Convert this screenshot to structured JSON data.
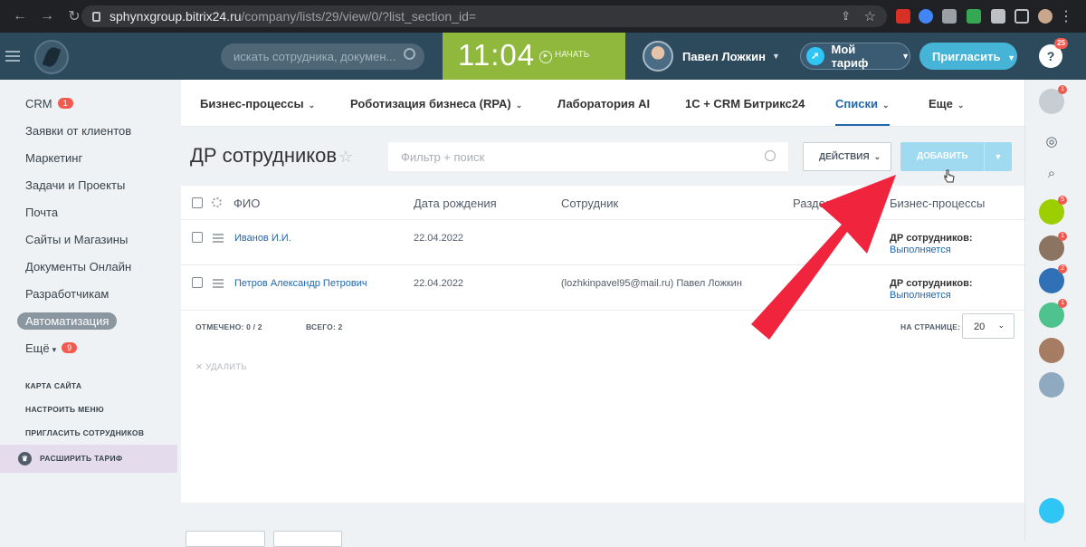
{
  "browser": {
    "url_host": "sphynxgroup.bitrix24.ru",
    "url_path": "/company/lists/29/view/0/?list_section_id="
  },
  "header": {
    "search_placeholder": "искать сотрудника, докумен...",
    "time": "11:04",
    "start_label": "НАЧАТЬ",
    "user_name": "Павел Ложкин",
    "tariff_label": "Мой тариф",
    "invite_label": "Пригласить",
    "help_badge": "25"
  },
  "sidebar": {
    "items": [
      {
        "label": "CRM",
        "badge": "1"
      },
      {
        "label": "Заявки от клиентов"
      },
      {
        "label": "Маркетинг"
      },
      {
        "label": "Задачи и Проекты"
      },
      {
        "label": "Почта"
      },
      {
        "label": "Сайты и Магазины"
      },
      {
        "label": "Документы Онлайн"
      },
      {
        "label": "Разработчикам"
      },
      {
        "label": "Автоматизация"
      },
      {
        "label": "Ещё",
        "badge": "9"
      }
    ],
    "links": [
      "КАРТА САЙТА",
      "НАСТРОИТЬ МЕНЮ",
      "ПРИГЛАСИТЬ СОТРУДНИКОВ"
    ],
    "upgrade_label": "РАСШИРИТЬ ТАРИФ"
  },
  "topnav": {
    "tabs": [
      {
        "label": "Бизнес-процессы"
      },
      {
        "label": "Роботизация бизнеса (RPA)"
      },
      {
        "label": "Лаборатория AI"
      },
      {
        "label": "1С + CRM Битрикс24"
      },
      {
        "label": "Списки"
      },
      {
        "label": "Еще"
      }
    ]
  },
  "page": {
    "title": "ДР сотрудников",
    "filter_placeholder": "Фильтр + поиск",
    "actions_label": "ДЕЙСТВИЯ",
    "add_label": "ДОБАВИТЬ"
  },
  "grid": {
    "columns": [
      "ФИО",
      "Дата рождения",
      "Сотрудник",
      "Разделы",
      "Бизнес-процессы"
    ],
    "rows": [
      {
        "name": "Иванов И.И.",
        "birth": "22.04.2022",
        "employee": "",
        "bp_title": "ДР сотрудников:",
        "bp_status": "Выполняется"
      },
      {
        "name": "Петров Александр Петрович",
        "birth": "22.04.2022",
        "employee": "(lozhkinpavel95@mail.ru) Павел Ложкин",
        "bp_title": "ДР сотрудников:",
        "bp_status": "Выполняется"
      }
    ],
    "selected_label": "ОТМЕЧЕНО:",
    "selected_value": "0 / 2",
    "total_label": "ВСЕГО:",
    "total_value": "2",
    "per_page_label": "НА СТРАНИЦЕ:",
    "per_page_value": "20",
    "delete_label": "УДАЛИТЬ"
  },
  "rightbar": {
    "badges": [
      "1",
      "5",
      "1",
      "2",
      "1"
    ]
  },
  "colors": {
    "header_bg": "#2d4a5d",
    "clock_bg": "#8fb83d",
    "accent": "#2067b0",
    "add_button": "#9fdaf0",
    "arrow": "#f0243c"
  }
}
